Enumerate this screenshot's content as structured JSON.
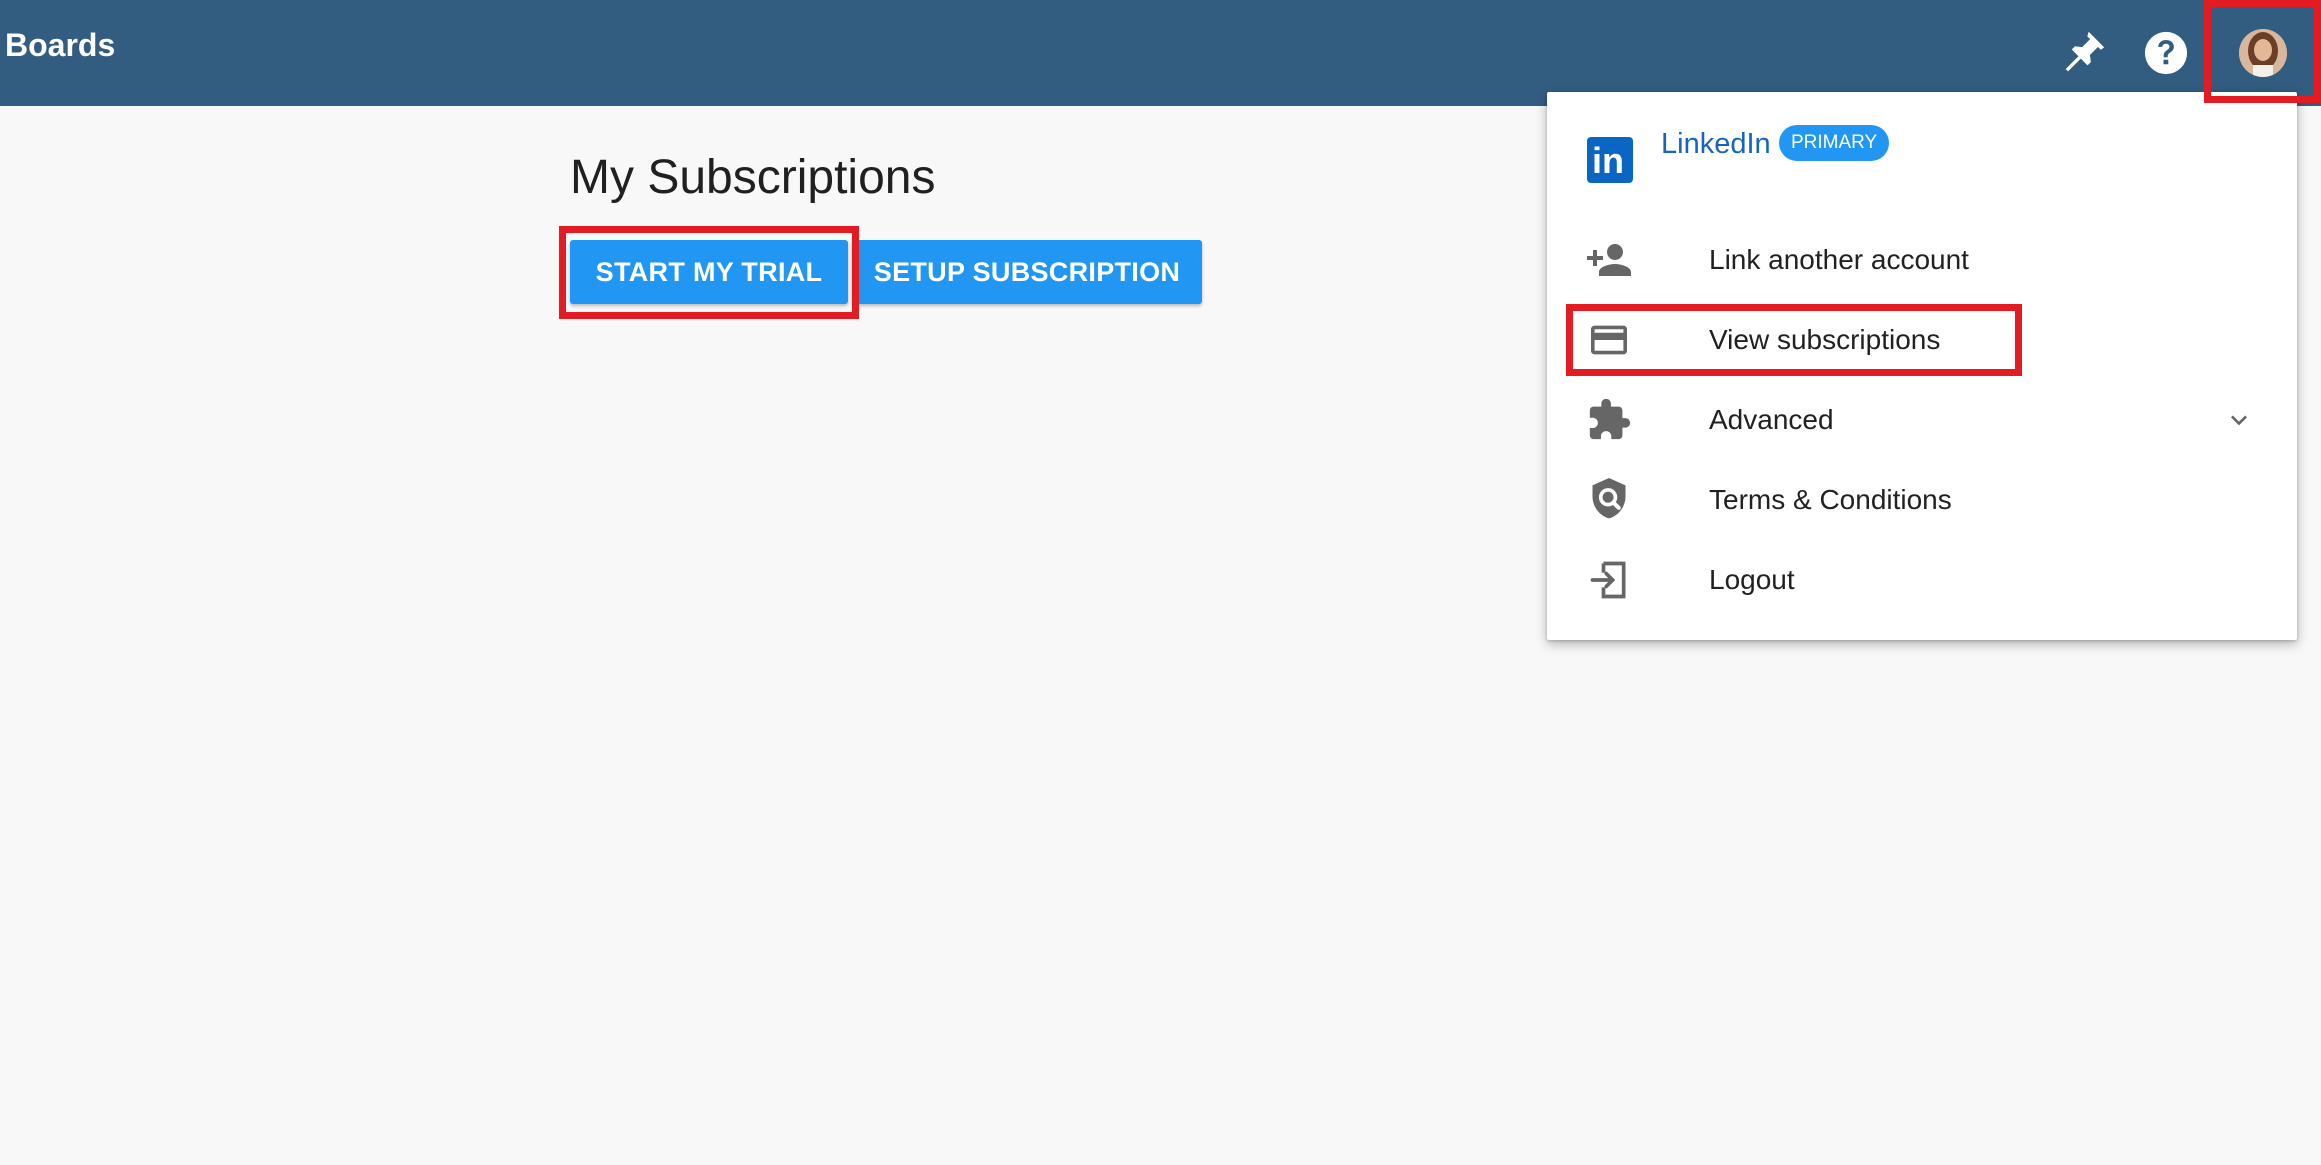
{
  "header": {
    "app_title": "Boards",
    "icons": [
      "pin-icon",
      "help-icon",
      "avatar"
    ]
  },
  "main": {
    "title": "My Subscriptions",
    "buttons": {
      "start_trial": "START MY TRIAL",
      "setup_subscription": "SETUP SUBSCRIPTION"
    }
  },
  "menu": {
    "account": {
      "name": "LinkedIn",
      "badge": "PRIMARY",
      "icon": "linkedin-icon",
      "logo_text": "in"
    },
    "items": [
      {
        "label": "Link another account",
        "icon": "person-add-icon"
      },
      {
        "label": "View subscriptions",
        "icon": "credit-card-icon"
      },
      {
        "label": "Advanced",
        "icon": "puzzle-icon"
      },
      {
        "label": "Terms & Conditions",
        "icon": "shield-search-icon"
      },
      {
        "label": "Logout",
        "icon": "logout-icon"
      }
    ]
  },
  "colors": {
    "topbar": "#325d81",
    "button": "#2196f3",
    "highlight": "#e31b23",
    "linkedin": "#0a66c2"
  }
}
